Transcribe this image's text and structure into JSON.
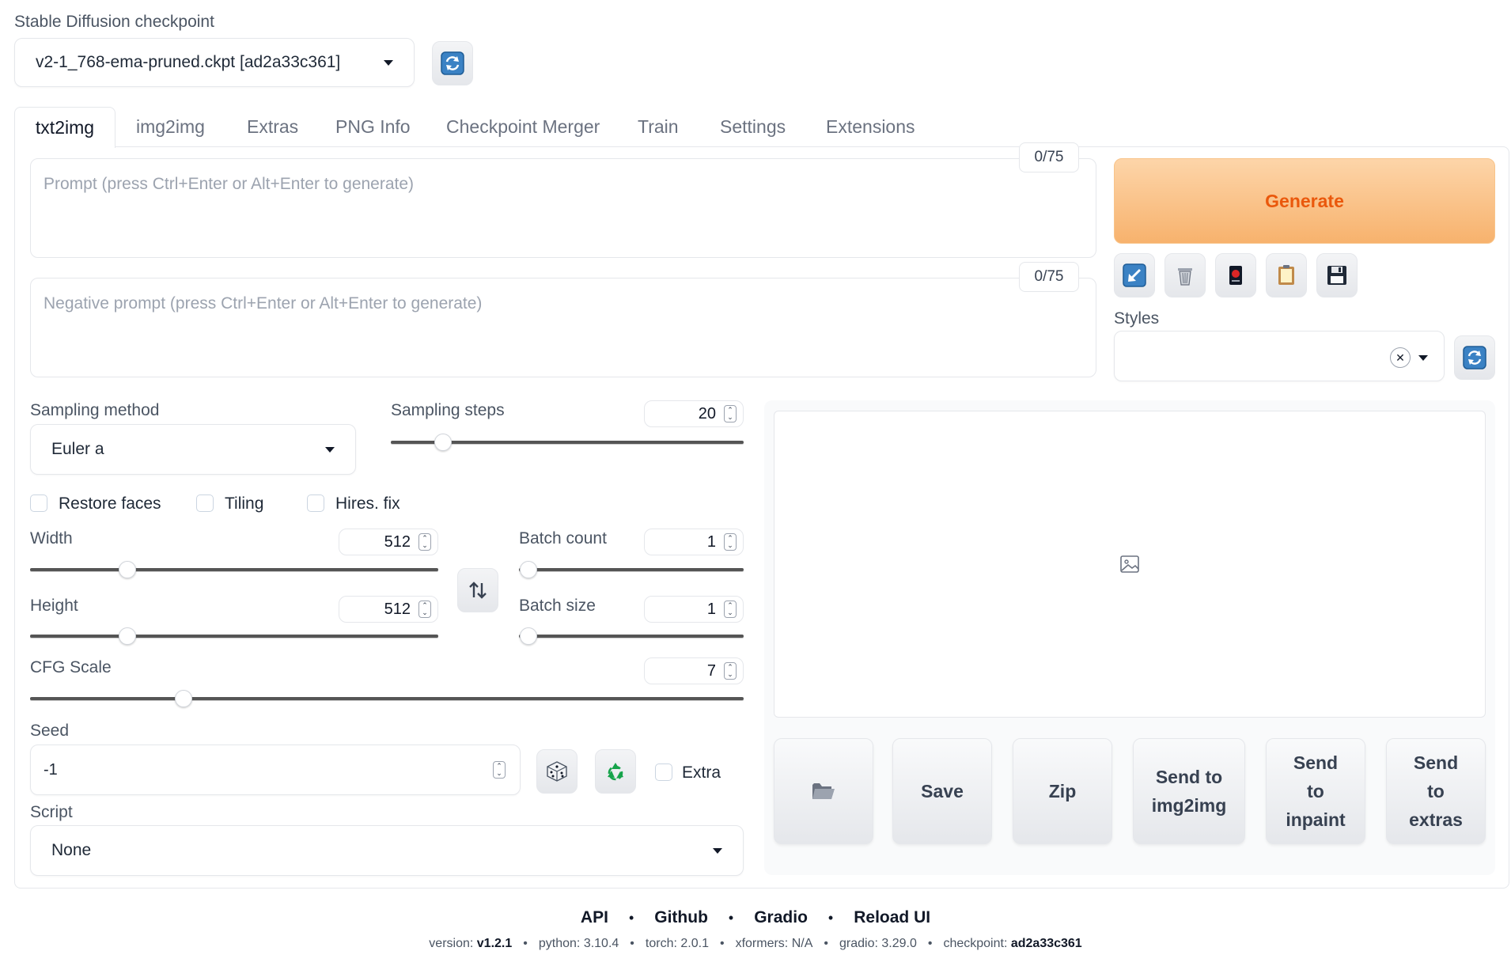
{
  "checkpoint": {
    "label": "Stable Diffusion checkpoint",
    "selected": "v2-1_768-ema-pruned.ckpt [ad2a33c361]",
    "refresh_icon": "refresh-icon"
  },
  "tabs": [
    "txt2img",
    "img2img",
    "Extras",
    "PNG Info",
    "Checkpoint Merger",
    "Train",
    "Settings",
    "Extensions"
  ],
  "active_tab": "txt2img",
  "prompt": {
    "placeholder": "Prompt (press Ctrl+Enter or Alt+Enter to generate)",
    "counter": "0/75"
  },
  "negative_prompt": {
    "placeholder": "Negative prompt (press Ctrl+Enter or Alt+Enter to generate)",
    "counter": "0/75"
  },
  "generate_label": "Generate",
  "tool_icons": [
    "paste-arrow-icon",
    "trash-icon",
    "red-card-icon",
    "clipboard-icon",
    "save-floppy-icon"
  ],
  "styles": {
    "label": "Styles",
    "clear_glyph": "✕"
  },
  "sampling": {
    "method_label": "Sampling method",
    "method_value": "Euler a",
    "steps_label": "Sampling steps",
    "steps_value": "20",
    "steps_min": 1,
    "steps_max": 150
  },
  "checkboxes": {
    "restore_faces": "Restore faces",
    "tiling": "Tiling",
    "hires_fix": "Hires. fix"
  },
  "width": {
    "label": "Width",
    "value": "512"
  },
  "height": {
    "label": "Height",
    "value": "512"
  },
  "batch_count": {
    "label": "Batch count",
    "value": "1"
  },
  "batch_size": {
    "label": "Batch size",
    "value": "1"
  },
  "cfg": {
    "label": "CFG Scale",
    "value": "7"
  },
  "seed": {
    "label": "Seed",
    "value": "-1",
    "extra_label": "Extra"
  },
  "script": {
    "label": "Script",
    "value": "None"
  },
  "output_buttons": {
    "save": "Save",
    "zip": "Zip",
    "send_img2img": "Send to img2img",
    "send_inpaint": "Send to inpaint",
    "send_extras": "Send to extras"
  },
  "footer": {
    "links": [
      "API",
      "Github",
      "Gradio",
      "Reload UI"
    ],
    "version_label": "version:",
    "version": "v1.2.1",
    "python_label": "python:",
    "python": "3.10.4",
    "torch_label": "torch:",
    "torch": "2.0.1",
    "xformers_label": "xformers:",
    "xformers": "N/A",
    "gradio_label": "gradio:",
    "gradio": "3.29.0",
    "checkpoint_label": "checkpoint:",
    "checkpoint": "ad2a33c361"
  }
}
